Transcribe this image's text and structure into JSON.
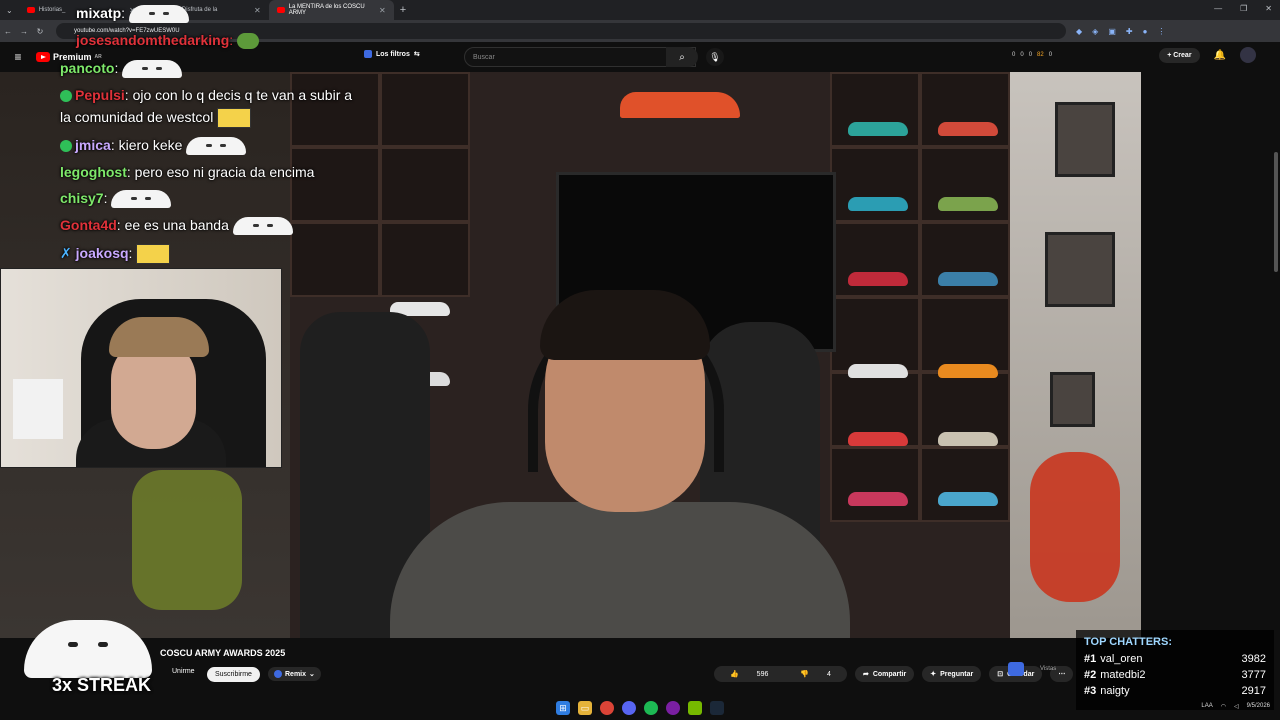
{
  "browser": {
    "tabs": [
      {
        "title": "Historias_"
      },
      {
        "title": "mate | Disfruta de la"
      },
      {
        "title": "La MENTIRA de los COSCU ARMY"
      }
    ],
    "url": "youtube.com/watch?v=FE7zwUESW0U"
  },
  "youtube": {
    "logo_text": "Premium",
    "logo_region": "AR",
    "filters_label": "Los filtros",
    "search_placeholder": "Buscar",
    "stats": [
      "0",
      "0",
      "0",
      "82",
      "0"
    ],
    "create_label": "Crear",
    "video_title": "COSCU ARMY AWARDS 2025",
    "channel_btn": "Unirme",
    "subscribe_label": "Suscribirme",
    "remix_label": "Remix",
    "likes": "596",
    "dislikes": "4",
    "share_label": "Compartir",
    "ask_label": "Preguntar",
    "save_label": "Guardar",
    "views_label": "Vistas"
  },
  "chat": [
    {
      "user": "mixatp",
      "text": ""
    },
    {
      "user": "josesandomthedarking",
      "text": ""
    },
    {
      "user": "pancoto",
      "text": ""
    },
    {
      "user": "Pepulsi",
      "text": "ojo con lo q decis q te van a subir a"
    },
    {
      "user": "",
      "text": "la comunidad de westcol"
    },
    {
      "user": "jmica",
      "text": "kiero keke"
    },
    {
      "user": "legoghost",
      "text": "pero eso ni gracia da encima"
    },
    {
      "user": "chisy7",
      "text": ""
    },
    {
      "user": "Gonta4d",
      "text": "ee es una banda"
    },
    {
      "user": "joakosq",
      "text": ""
    }
  ],
  "streak": "3x STREAK",
  "top_chatters": {
    "title": "TOP CHATTERS:",
    "rows": [
      {
        "rank": "#1",
        "name": "val_oren",
        "count": "3982"
      },
      {
        "rank": "#2",
        "name": "matedbi2",
        "count": "3777"
      },
      {
        "rank": "#3",
        "name": "naigty",
        "count": "2917"
      }
    ]
  },
  "tray": {
    "lang": "LAA",
    "date": "9/5/2026"
  },
  "colors": {
    "accent": "#3e6ae1",
    "yt_red": "#ff0000",
    "chat_green": "#2fbf58",
    "chat_red": "#e0323a"
  }
}
